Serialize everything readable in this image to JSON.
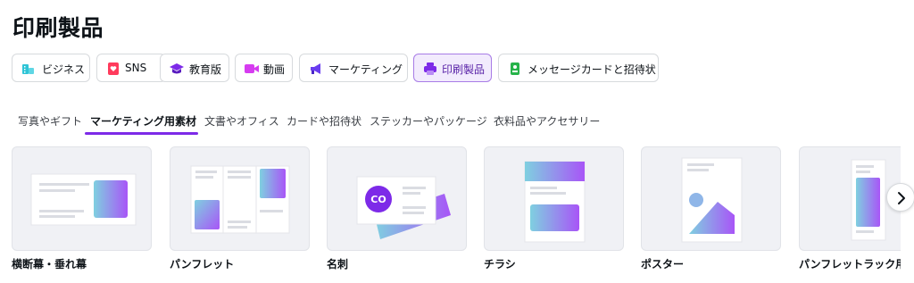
{
  "page": {
    "title": "印刷製品"
  },
  "categories": [
    {
      "label": "ビジネス",
      "icon": "business-icon",
      "color": "#2ec4d6"
    },
    {
      "label": "SNS",
      "icon": "heart-icon",
      "color": "#ff3b5c"
    },
    {
      "label": "教育版",
      "icon": "graduation-cap-icon",
      "color": "#7d2ae8"
    },
    {
      "label": "動画",
      "icon": "video-icon",
      "color": "#d63cf0"
    },
    {
      "label": "マーケティング",
      "icon": "megaphone-icon",
      "color": "#6a3df0"
    },
    {
      "label": "印刷製品",
      "icon": "printer-icon",
      "color": "#7d2ae8",
      "active": true
    },
    {
      "label": "メッセージカードと招待状",
      "icon": "card-icon",
      "color": "#27b34a"
    }
  ],
  "subtabs": [
    {
      "label": "写真やギフト"
    },
    {
      "label": "マーケティング用素材",
      "active": true
    },
    {
      "label": "文書やオフィス"
    },
    {
      "label": "カードや招待状"
    },
    {
      "label": "ステッカーやパッケージ"
    },
    {
      "label": "衣料品やアクセサリー"
    }
  ],
  "cards": [
    {
      "label": "横断幕・垂れ幕",
      "icon": "banner-icon"
    },
    {
      "label": "パンフレット",
      "icon": "brochure-icon"
    },
    {
      "label": "名刺",
      "icon": "business-card-icon",
      "badge": "CO"
    },
    {
      "label": "チラシ",
      "icon": "flyer-icon"
    },
    {
      "label": "ポスター",
      "icon": "poster-icon"
    },
    {
      "label": "パンフレットラック用",
      "icon": "rack-card-icon"
    }
  ],
  "controls": {
    "next_icon": "chevron-right-icon"
  },
  "colors": {
    "accent": "#7d2ae8",
    "gradient_start": "#7fd0e0",
    "gradient_end": "#a855f7"
  }
}
